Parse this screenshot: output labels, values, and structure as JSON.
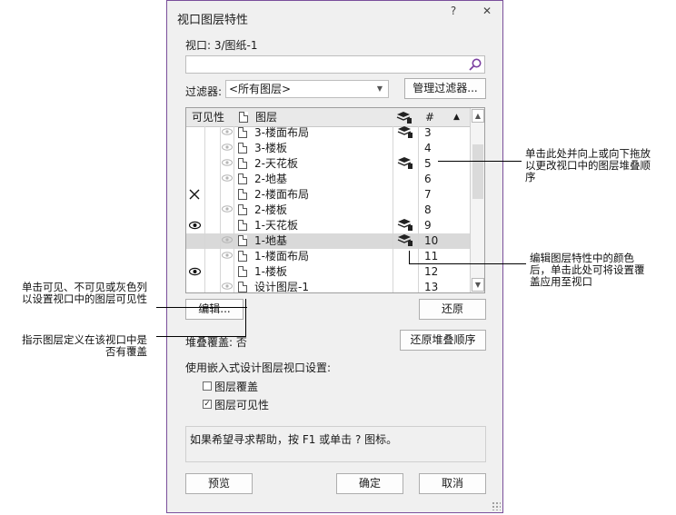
{
  "dialog": {
    "title": "视口图层特性",
    "help_btn": "?",
    "close_btn": "✕",
    "viewport_label": "视口: 3/图纸-1",
    "filter_label": "过滤器:",
    "filter_value": "<所有图层>",
    "manage_filters": "管理过滤器...",
    "col_visibility": "可见性",
    "col_layer": "图层",
    "col_number": "#",
    "rows": [
      {
        "name": "3-楼面布局",
        "num": "3",
        "vis": "eye-dim",
        "cap": true,
        "sel": false
      },
      {
        "name": "3-楼板",
        "num": "4",
        "vis": "eye-dim",
        "cap": false,
        "sel": false
      },
      {
        "name": "2-天花板",
        "num": "5",
        "vis": "eye-dim",
        "cap": true,
        "sel": false
      },
      {
        "name": "2-地基",
        "num": "6",
        "vis": "eye-dim",
        "cap": false,
        "sel": false
      },
      {
        "name": "2-楼面布局",
        "num": "7",
        "vis": "none",
        "cap": false,
        "sel": false
      },
      {
        "name": "2-楼板",
        "num": "8",
        "vis": "eye-dim",
        "cap": false,
        "sel": false
      },
      {
        "name": "1-天花板",
        "num": "9",
        "vis": "none",
        "cap": true,
        "sel": false
      },
      {
        "name": "1-地基",
        "num": "10",
        "vis": "eye-dim",
        "cap": true,
        "sel": true
      },
      {
        "name": "1-楼面布局",
        "num": "11",
        "vis": "eye-dim",
        "cap": false,
        "sel": false
      },
      {
        "name": "1-楼板",
        "num": "12",
        "vis": "none",
        "cap": false,
        "sel": false
      },
      {
        "name": "设计图层-1",
        "num": "13",
        "vis": "eye-dim",
        "cap": false,
        "sel": false
      }
    ],
    "edit_btn": "编辑...",
    "restore_btn": "还原",
    "overlay_label": "堆叠覆盖: 否",
    "restore_stack_btn": "还原堆叠顺序",
    "embedded_label": "使用嵌入式设计图层视口设置:",
    "chk_overlay": "图层覆盖",
    "chk_overlay_checked": false,
    "chk_visibility": "图层可见性",
    "chk_visibility_checked": true,
    "help_text": "如果希望寻求帮助，按 F1 或单击 ? 图标。",
    "preview_btn": "预览",
    "ok_btn": "确定",
    "cancel_btn": "取消"
  },
  "annotations": {
    "drag_note": "单击此处并向上或向下拖放\n以更改视口中的图层堆叠顺\n序",
    "edit_note": "编辑图层特性中的颜色\n后，单击此处可将设置覆\n盖应用至视口",
    "vis_note": "单击可见、不可见或灰色列\n以设置视口中的图层可见性",
    "override_note": "指示图层定义在该视口中是\n否有覆盖"
  }
}
